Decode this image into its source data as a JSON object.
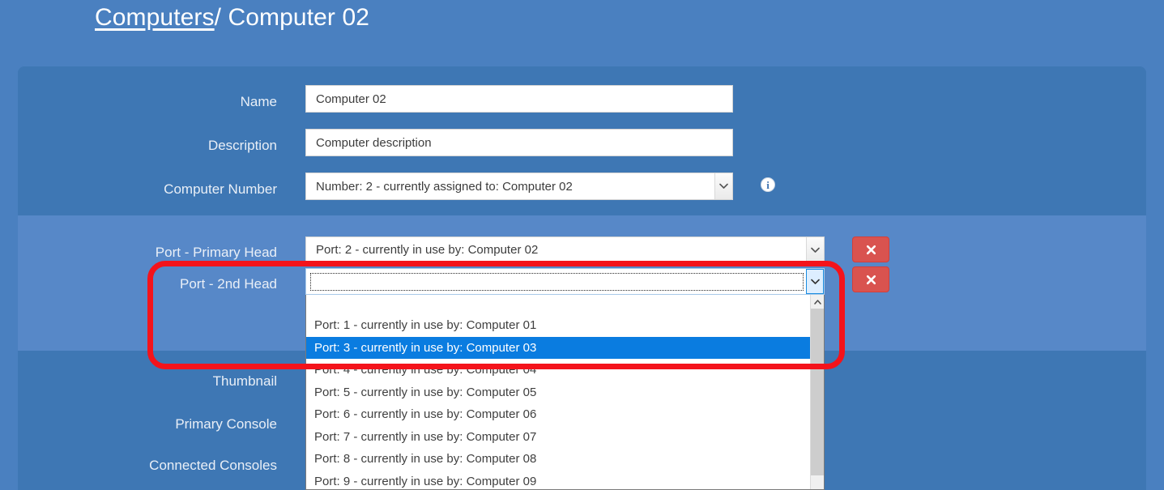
{
  "header": {
    "parent_link": "Computers",
    "separator": "/",
    "current": "Computer 02"
  },
  "form": {
    "fields": [
      {
        "label": "Name",
        "value": "Computer 02",
        "type": "text"
      },
      {
        "label": "Description",
        "value": "Computer description",
        "type": "text"
      },
      {
        "label": "Computer Number",
        "value": "Number: 2 - currently assigned to: Computer 02",
        "type": "select"
      }
    ],
    "ports": [
      {
        "label": "Port - Primary Head",
        "value": "Port: 2 - currently in use by: Computer 02",
        "state": "closed"
      },
      {
        "label": "Port - 2nd Head",
        "value": "",
        "state": "open"
      }
    ],
    "lower_labels": [
      {
        "label": "Thumbnail"
      },
      {
        "label": "Primary Console"
      },
      {
        "label": "Connected Consoles"
      }
    ],
    "remove_button_label": "✖",
    "info_icon_label": "i"
  },
  "dropdown": {
    "options": [
      {
        "text": "",
        "blank": true,
        "selected": false
      },
      {
        "text": "Port: 1 - currently in use by: Computer 01",
        "blank": false,
        "selected": false
      },
      {
        "text": "Port: 3 - currently in use by: Computer 03",
        "blank": false,
        "selected": true
      },
      {
        "text": "Port: 4 - currently in use by: Computer 04",
        "blank": false,
        "selected": false
      },
      {
        "text": "Port: 5 - currently in use by: Computer 05",
        "blank": false,
        "selected": false
      },
      {
        "text": "Port: 6 - currently in use by: Computer 06",
        "blank": false,
        "selected": false
      },
      {
        "text": "Port: 7 - currently in use by: Computer 07",
        "blank": false,
        "selected": false
      },
      {
        "text": "Port: 8 - currently in use by: Computer 08",
        "blank": false,
        "selected": false
      },
      {
        "text": "Port: 9 - currently in use by: Computer 09",
        "blank": false,
        "selected": false
      }
    ]
  },
  "colors": {
    "page_background": "#4a80c0",
    "band_dark": "#3e77b4",
    "band_light": "#5788c8",
    "highlight_selection": "#0a7ce0",
    "danger_button": "#d9534f",
    "annotation": "#f4131b"
  }
}
